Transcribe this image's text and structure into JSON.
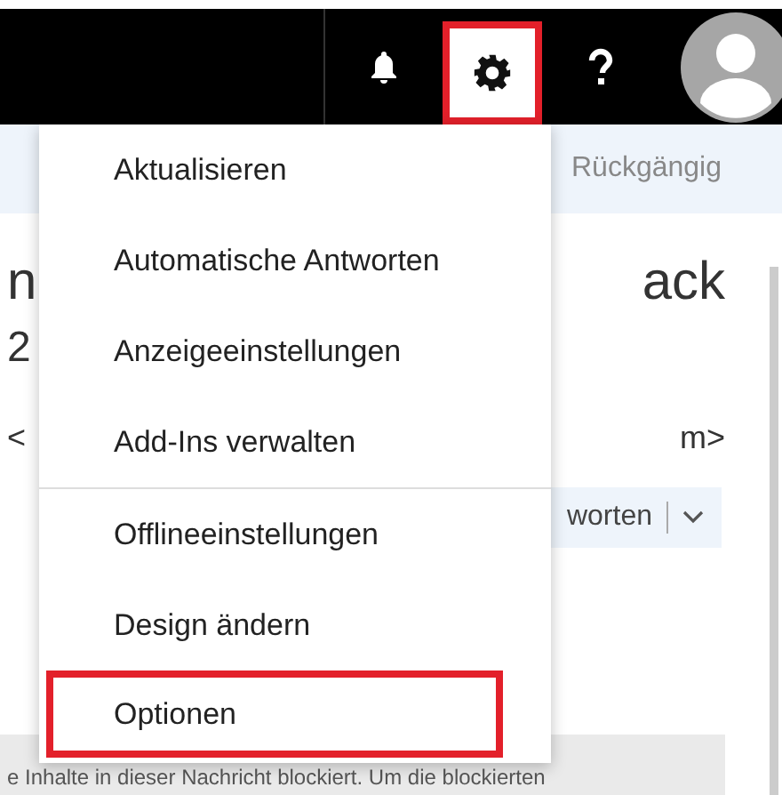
{
  "top_bar": {
    "settings_highlighted": true
  },
  "toolbar": {
    "undo": "Rückgängig"
  },
  "message": {
    "subject_start": "n",
    "subject_end": "ack",
    "date_start": "2",
    "sender_start": "<",
    "sender_end": "m>",
    "reply": "worten",
    "blocked_notice": "e Inhalte in dieser Nachricht blockiert. Um die blockierten"
  },
  "settings_menu": [
    {
      "label": "Aktualisieren",
      "separator_before": false,
      "highlighted": false
    },
    {
      "label": "Automatische Antworten",
      "separator_before": false,
      "highlighted": false
    },
    {
      "label": "Anzeigeeinstellungen",
      "separator_before": false,
      "highlighted": false
    },
    {
      "label": "Add-Ins verwalten",
      "separator_before": false,
      "highlighted": false
    },
    {
      "label": "Offlineeinstellungen",
      "separator_before": true,
      "highlighted": false
    },
    {
      "label": "Design ändern",
      "separator_before": false,
      "highlighted": false
    },
    {
      "label": "Optionen",
      "separator_before": false,
      "highlighted": true
    }
  ]
}
